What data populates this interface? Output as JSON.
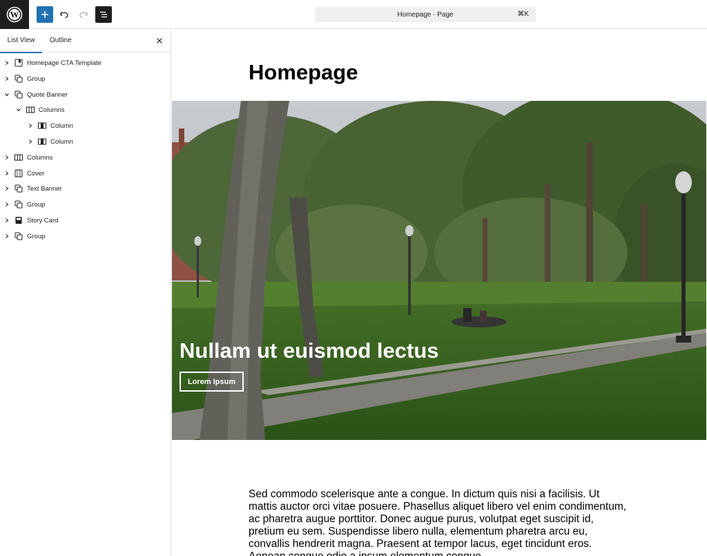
{
  "toolbar": {
    "logo_icon": "wordpress-logo-icon",
    "add_icon": "plus-icon",
    "undo_icon": "undo-icon",
    "redo_icon": "redo-icon",
    "listview_icon": "list-view-icon",
    "command_title": "Homepage · Page",
    "command_shortcut": "⌘K"
  },
  "sidebar": {
    "tabs": [
      {
        "label": "List View",
        "active": true
      },
      {
        "label": "Outline",
        "active": false
      }
    ],
    "close_icon": "close-icon",
    "tree": [
      {
        "label": "Homepage CTA Template",
        "icon": "template-part-icon",
        "level": 0,
        "expanded": false
      },
      {
        "label": "Group",
        "icon": "group-icon",
        "level": 0,
        "expanded": false
      },
      {
        "label": "Quote Banner",
        "icon": "group-icon",
        "level": 0,
        "expanded": true
      },
      {
        "label": "Columns",
        "icon": "columns-icon",
        "level": 1,
        "expanded": true
      },
      {
        "label": "Column",
        "icon": "column-icon",
        "level": 2,
        "expanded": false
      },
      {
        "label": "Column",
        "icon": "column-icon",
        "level": 2,
        "expanded": false
      },
      {
        "label": "Columns",
        "icon": "columns-icon",
        "level": 0,
        "expanded": false
      },
      {
        "label": "Cover",
        "icon": "cover-icon",
        "level": 0,
        "expanded": false
      },
      {
        "label": "Text Banner",
        "icon": "group-icon",
        "level": 0,
        "expanded": false
      },
      {
        "label": "Group",
        "icon": "group-icon",
        "level": 0,
        "expanded": false
      },
      {
        "label": "Story Card",
        "icon": "story-card-icon",
        "level": 0,
        "expanded": false
      },
      {
        "label": "Group",
        "icon": "group-icon",
        "level": 0,
        "expanded": false
      }
    ]
  },
  "canvas": {
    "page_title": "Homepage",
    "cover_heading": "Nullam ut euismod lectus",
    "cover_button": "Lorem Ipsum",
    "body_text": "Sed commodo scelerisque ante a congue. In dictum quis nisi a facilisis. Ut mattis auctor orci vitae posuere. Phasellus aliquet libero vel enim condimentum, ac pharetra augue porttitor. Donec augue purus, volutpat eget suscipit id, pretium eu sem. Suspendisse libero nulla, elementum pharetra arcu eu, convallis hendrerit magna. Praesent at tempor lacus, eget tincidunt eros. Aenean congue odio a ipsum elementum congue."
  },
  "colors": {
    "accent": "#2271b1",
    "dark": "#1e1e1e",
    "border": "#e0e0e0"
  }
}
